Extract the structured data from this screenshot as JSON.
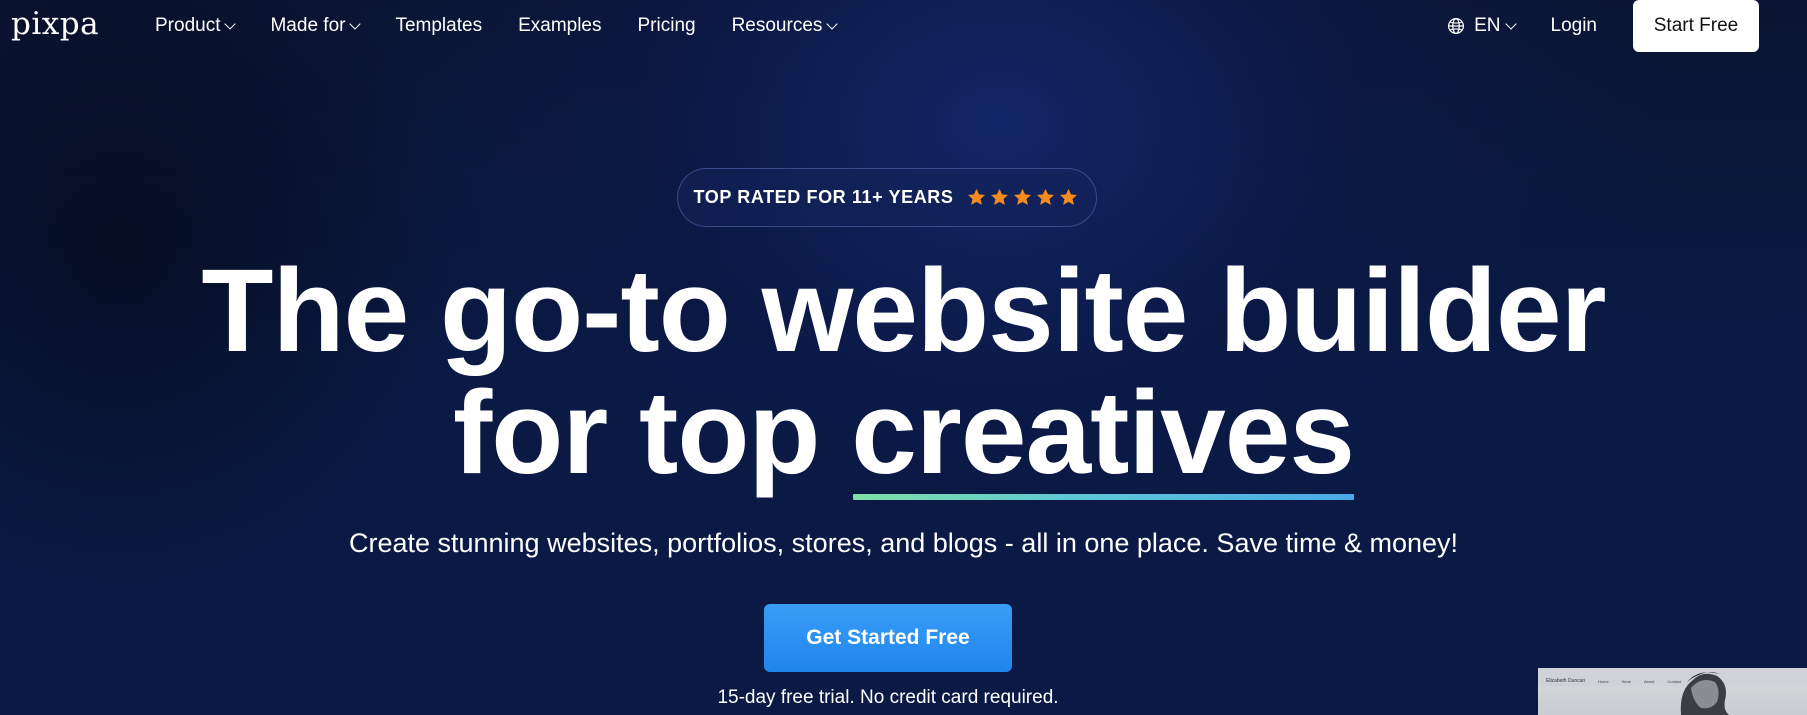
{
  "brand": {
    "logo_text": "pixpa"
  },
  "nav": {
    "items": [
      {
        "label": "Product",
        "has_dropdown": true
      },
      {
        "label": "Made for",
        "has_dropdown": true
      },
      {
        "label": "Templates",
        "has_dropdown": false
      },
      {
        "label": "Examples",
        "has_dropdown": false
      },
      {
        "label": "Pricing",
        "has_dropdown": false
      },
      {
        "label": "Resources",
        "has_dropdown": true
      }
    ],
    "language": "EN",
    "login_label": "Login",
    "start_free_label": "Start Free"
  },
  "hero": {
    "badge_text": "TOP RATED FOR 11+ YEARS",
    "star_count": 5,
    "headline_line1": "The go-to website builder",
    "headline_line2_prefix": "for top ",
    "headline_highlight": "creatives",
    "subtitle": "Create stunning websites, portfolios, stores, and blogs - all in one place. Save time & money!",
    "cta_label": "Get Started Free",
    "trial_note": "15-day free trial. No credit card required."
  },
  "preview": {
    "site_name": "Elizabeth Duncan",
    "nav_items": [
      "Home",
      "Work",
      "About",
      "Contact"
    ]
  },
  "colors": {
    "background": "#0a1a45",
    "accent_blue": "#1f86ee",
    "star_orange": "#f58a1f",
    "underline_start": "#7ee0a6",
    "underline_end": "#4aa8e8"
  },
  "icons": {
    "globe": "globe-icon",
    "star": "star-icon",
    "dropdown": "chevron-down-icon"
  }
}
